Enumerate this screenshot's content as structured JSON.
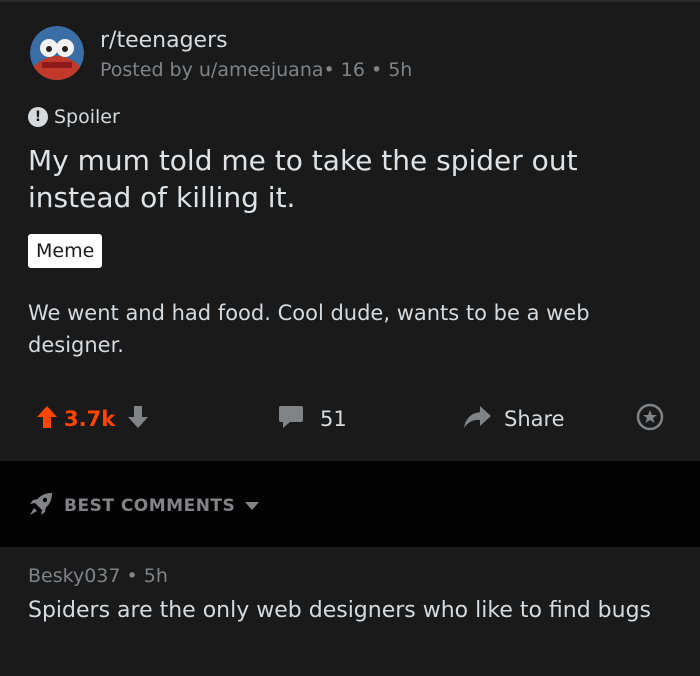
{
  "post": {
    "subreddit": "r/teenagers",
    "meta": "Posted by u/ameejuana• 16 • 5h",
    "spoiler_label": "Spoiler",
    "title": "My mum told me to take the spider out instead of killing it.",
    "flair": "Meme",
    "body": "We went and had food. Cool dude, wants to be a web designer.",
    "votes": "3.7k",
    "comments_count": "51",
    "share_label": "Share"
  },
  "comments_section": {
    "sort_label": "BEST COMMENTS"
  },
  "comment": {
    "meta": "Besky037 • 5h",
    "text": "Spiders are the only web designers who like to find bugs"
  },
  "colors": {
    "background": "#1a1a1b",
    "upvote": "#ff4500",
    "muted": "#818384",
    "text": "#d7dadc"
  },
  "icons": [
    "subreddit-avatar",
    "spoiler-icon",
    "upvote-icon",
    "downvote-icon",
    "comment-icon",
    "share-icon",
    "award-icon",
    "rocket-icon",
    "caret-down-icon"
  ]
}
